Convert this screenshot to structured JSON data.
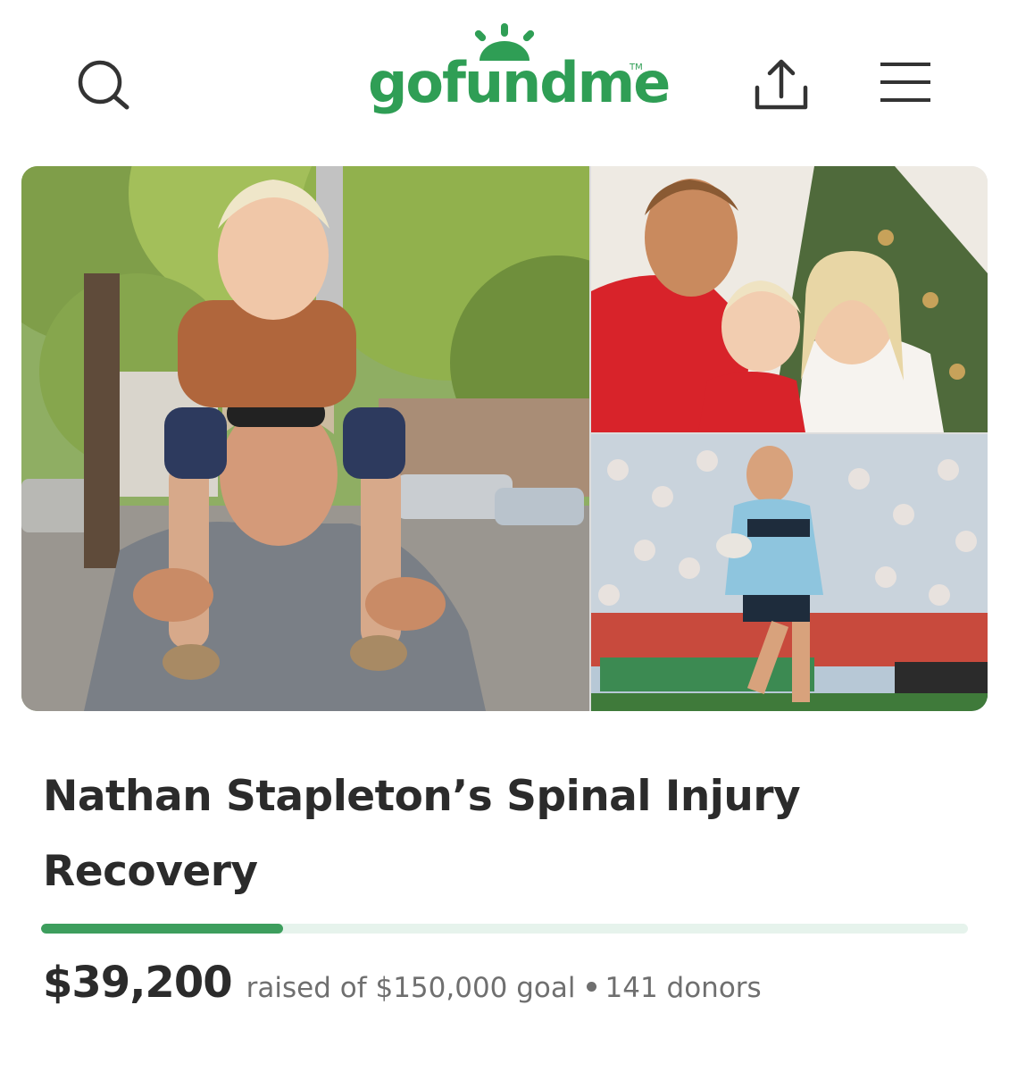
{
  "header": {
    "logo_text": "gofundme",
    "logo_tm": "TM",
    "icons": [
      "search-icon",
      "share-icon",
      "menu-icon"
    ],
    "brand_color": "#2f9e55"
  },
  "gallery": {
    "photos": [
      "man-with-child-on-shoulders-photo",
      "family-christmas-photo",
      "rugby-player-photo"
    ]
  },
  "campaign": {
    "title": "Nathan Stapleton’s Spinal Injury Recovery",
    "amount_raised": "$39,200",
    "goal_text": "raised of $150,000 goal",
    "donors_text": "141 donors",
    "progress_fraction": 0.2613,
    "progress_color": "#3d9e5d",
    "track_color": "#e6f3ec"
  }
}
